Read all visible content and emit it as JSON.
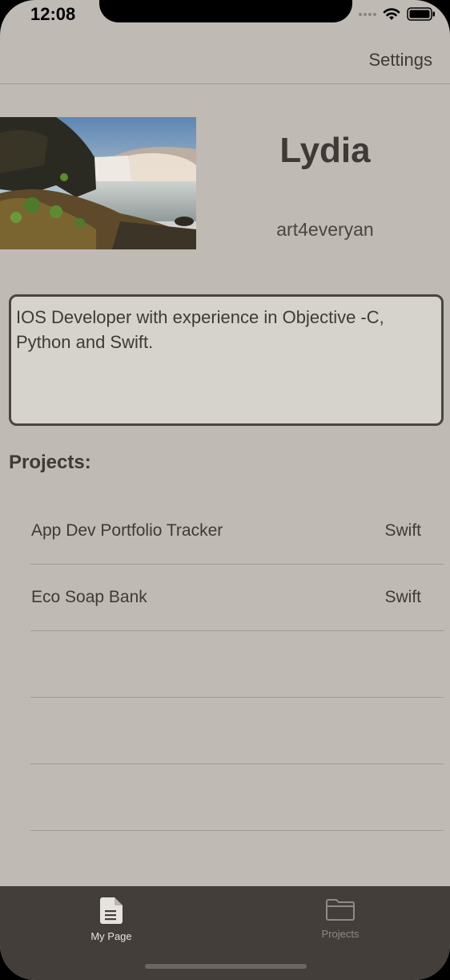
{
  "status_bar": {
    "time": "12:08",
    "icons": [
      "cellular-signal-icon",
      "wifi-icon",
      "battery-icon"
    ]
  },
  "navbar": {
    "settings_label": "Settings"
  },
  "profile": {
    "photo_icon": "waterfall-photo",
    "name": "Lydia",
    "username": "art4everyan",
    "bio": "IOS Developer with experience in Objective -C, Python and Swift."
  },
  "projects": {
    "heading": "Projects:",
    "items": [
      {
        "title": "App Dev Portfolio Tracker",
        "language": "Swift"
      },
      {
        "title": "Eco Soap Bank",
        "language": "Swift"
      },
      {
        "title": "",
        "language": ""
      },
      {
        "title": "",
        "language": ""
      },
      {
        "title": "",
        "language": ""
      }
    ]
  },
  "tab_bar": {
    "tabs": [
      {
        "label": "My Page",
        "icon": "document-icon",
        "selected": true
      },
      {
        "label": "Projects",
        "icon": "folder-icon",
        "selected": false
      }
    ]
  },
  "colors": {
    "background": "#bfbab4",
    "text": "#3f3a35",
    "tab_bar": "#433e39",
    "tab_selected": "#e6e2dd",
    "tab_unselected": "#8f8a84"
  }
}
